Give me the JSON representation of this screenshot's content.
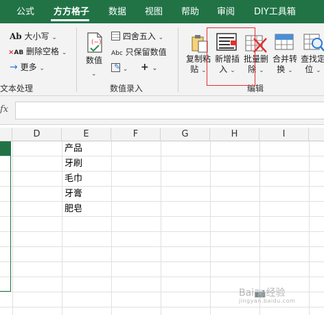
{
  "tabs": [
    "公式",
    "方方格子",
    "数据",
    "视图",
    "帮助",
    "审阅",
    "DIY工具箱"
  ],
  "ribbon": {
    "text_group": {
      "items": [
        {
          "icon": "ab-case-icon",
          "label": "大小写"
        },
        {
          "icon": "delete-spaces-icon",
          "label": "删除空格"
        },
        {
          "icon": "arrow-right-icon",
          "label": "更多"
        }
      ],
      "label": "文本处理"
    },
    "number_group": {
      "big_button": {
        "label": "数值"
      },
      "items": [
        {
          "icon": "rounding-icon",
          "label": "四舍五入"
        },
        {
          "icon": "keep-numbers-icon",
          "label": "只保留数值"
        }
      ],
      "label": "数值录入"
    },
    "edit_group": {
      "buttons": [
        {
          "line1": "复制粘",
          "line2": "贴"
        },
        {
          "line1": "新增插",
          "line2": "入"
        },
        {
          "line1": "批量删",
          "line2": "除"
        },
        {
          "line1": "合并转",
          "line2": "换"
        },
        {
          "line1": "查找定",
          "line2": "位"
        }
      ],
      "label": "编辑"
    }
  },
  "formula_bar": {
    "fx": "fx",
    "value": ""
  },
  "columns": [
    "D",
    "E",
    "F",
    "G",
    "H",
    "I"
  ],
  "cells_E": [
    "产品",
    "牙刷",
    "毛巾",
    "牙膏",
    "肥皂"
  ],
  "watermark": {
    "text": "Bai📷经验",
    "sub": "jingyan.baidu.com"
  },
  "colors": {
    "accent": "#217346",
    "highlight": "#e03030"
  }
}
